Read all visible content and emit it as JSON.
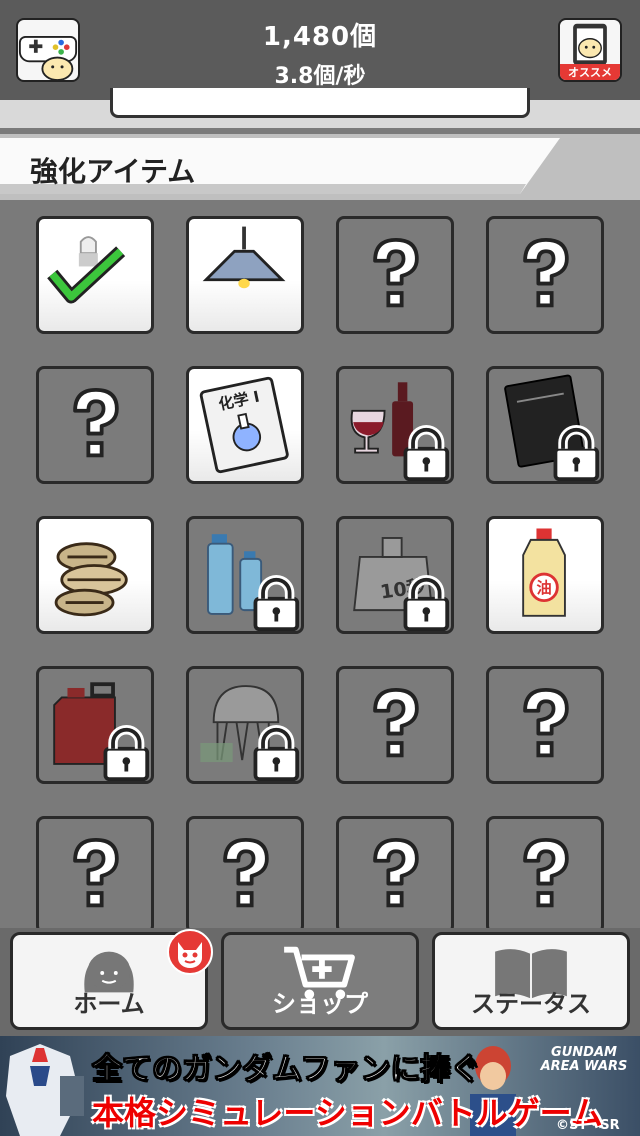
{
  "header": {
    "count": "1,480個",
    "rate": "3.8個/秒",
    "left_button_icon": "game-controller-icon",
    "right_button_label": "オススメ"
  },
  "section": {
    "title": "強化アイテム"
  },
  "items": [
    {
      "state": "unlocked",
      "icon": "eye-drop-check-icon"
    },
    {
      "state": "unlocked",
      "icon": "ceiling-lamp-icon"
    },
    {
      "state": "unknown",
      "icon": "question-mark-icon"
    },
    {
      "state": "unknown",
      "icon": "question-mark-icon"
    },
    {
      "state": "unknown",
      "icon": "question-mark-icon"
    },
    {
      "state": "unlocked",
      "icon": "chemistry-book-icon",
      "text": "化学 I"
    },
    {
      "state": "locked",
      "icon": "wine-icon"
    },
    {
      "state": "locked",
      "icon": "black-book-icon"
    },
    {
      "state": "unlocked",
      "icon": "seeds-icon"
    },
    {
      "state": "locked",
      "icon": "water-bottles-icon"
    },
    {
      "state": "locked",
      "icon": "ten-second-pouch-icon",
      "text": "10秒"
    },
    {
      "state": "unlocked",
      "icon": "oil-bottle-icon",
      "text": "油"
    },
    {
      "state": "locked",
      "icon": "jerry-can-icon"
    },
    {
      "state": "locked",
      "icon": "jellyfish-icon"
    },
    {
      "state": "unknown",
      "icon": "question-mark-icon"
    },
    {
      "state": "unknown",
      "icon": "question-mark-icon"
    },
    {
      "state": "unknown",
      "icon": "question-mark-icon"
    },
    {
      "state": "unknown",
      "icon": "question-mark-icon"
    },
    {
      "state": "unknown",
      "icon": "question-mark-icon"
    },
    {
      "state": "unknown",
      "icon": "question-mark-icon"
    }
  ],
  "nav": {
    "home": "ホーム",
    "shop": "ショップ",
    "status": "ステータス",
    "active": "shop"
  },
  "ad": {
    "line1": "全てのガンダムファンに捧ぐ",
    "line2": "本格シミュレーションバトルゲーム",
    "logo": "GUNDAM AREA WARS",
    "copyright": "©ST・SR"
  },
  "colors": {
    "header_bg": "#5b5b5b",
    "panel_bg": "#7a7a7a",
    "check_green": "#3cc63c",
    "badge_red": "#e53935"
  }
}
